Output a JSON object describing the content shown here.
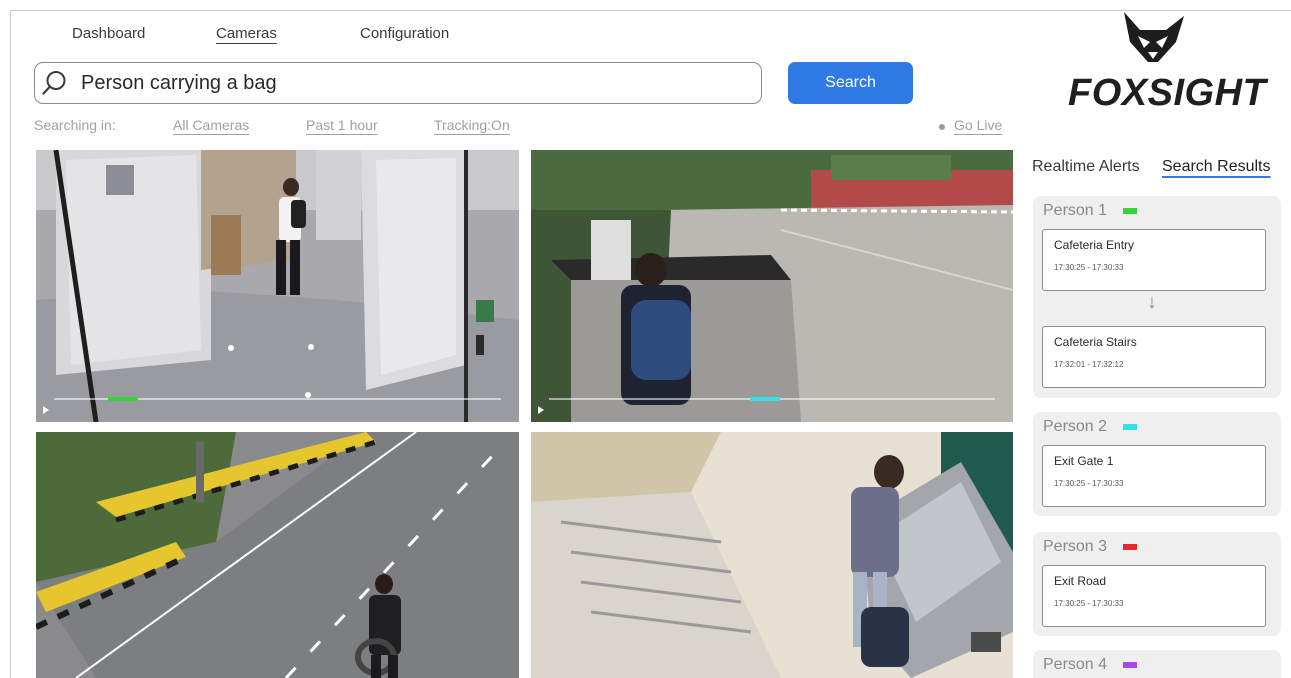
{
  "nav": {
    "items": [
      {
        "label": "Dashboard",
        "active": false
      },
      {
        "label": "Cameras",
        "active": true
      },
      {
        "label": "Configuration",
        "active": false
      }
    ]
  },
  "search": {
    "icon": "search-icon",
    "value": "Person carrying a bag",
    "button_label": "Search"
  },
  "filters": {
    "prefix": "Searching in:",
    "cameras": "All Cameras",
    "time": "Past 1 hour",
    "tracking": "Tracking:On",
    "go_live": "Go Live"
  },
  "brand": {
    "name": "FOXSIGHT",
    "logo_icon": "fox-head-logo"
  },
  "cameras": [
    {
      "scene": "indoor corridor, person with backpack",
      "timeline_color": "#3bd13b",
      "timeline_progress": 0.15
    },
    {
      "scene": "outdoor plaza, person with blue backpack",
      "timeline_color": "#35e0e8",
      "timeline_progress": 0.47
    },
    {
      "scene": "road, man carrying bag",
      "timeline_color": null,
      "timeline_progress": null
    },
    {
      "scene": "stairwell, person with bag on bench",
      "timeline_color": null,
      "timeline_progress": null
    }
  ],
  "panel": {
    "tabs": [
      {
        "label": "Realtime Alerts",
        "active": false
      },
      {
        "label": "Search Results",
        "active": true
      }
    ],
    "persons": [
      {
        "label": "Person 1",
        "color": "#3bd13b",
        "locations": [
          {
            "name": "Cafeteria Entry",
            "time": "17:30:25 - 17:30:33"
          },
          {
            "name": "Cafeteria Stairs",
            "time": "17:32:01 - 17:32:12"
          }
        ]
      },
      {
        "label": "Person 2",
        "color": "#35e0e8",
        "locations": [
          {
            "name": "Exit Gate 1",
            "time": "17:30:25 - 17:30:33"
          }
        ]
      },
      {
        "label": "Person 3",
        "color": "#e8282e",
        "locations": [
          {
            "name": "Exit Road",
            "time": "17:30:25 - 17:30:33"
          }
        ]
      },
      {
        "label": "Person 4",
        "color": "#a64ce6",
        "locations": []
      }
    ]
  }
}
